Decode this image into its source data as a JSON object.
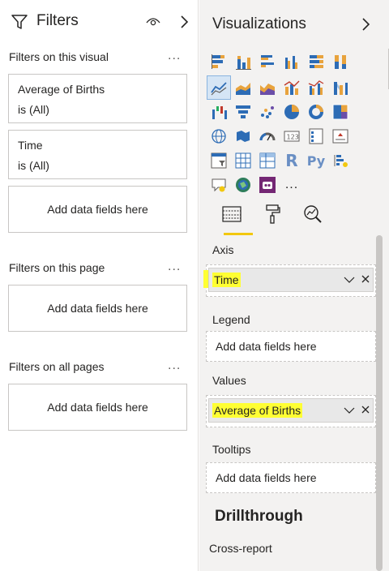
{
  "filters": {
    "title": "Filters",
    "icons": {
      "funnel": "filter-funnel-icon",
      "eye": "eye-icon",
      "collapse": "chevron-right-icon"
    },
    "on_visual": {
      "label": "Filters on this visual",
      "more": "...",
      "cards": [
        {
          "name": "Average of Births",
          "state": "is (All)"
        },
        {
          "name": "Time",
          "state": "is (All)"
        }
      ],
      "add": "Add data fields here"
    },
    "on_page": {
      "label": "Filters on this page",
      "more": "...",
      "add": "Add data fields here"
    },
    "all_pages": {
      "label": "Filters on all pages",
      "more": "...",
      "add": "Add data fields here"
    }
  },
  "viz": {
    "title": "Visualizations",
    "collapse_icon": "chevron-right-icon",
    "more_visuals": "...",
    "r_label": "R",
    "py_label": "Py",
    "selected_visual": "line-chart-icon",
    "tabs": [
      "fields-tab-icon",
      "format-paint-roller-icon",
      "analytics-magnifier-icon"
    ],
    "wells": {
      "axis": {
        "label": "Axis",
        "field": "Time"
      },
      "legend": {
        "label": "Legend",
        "placeholder": "Add data fields here"
      },
      "values": {
        "label": "Values",
        "field": "Average of Births"
      },
      "tooltips": {
        "label": "Tooltips",
        "placeholder": "Add data fields here"
      }
    },
    "drillthrough": {
      "title": "Drillthrough",
      "cross_report": "Cross-report"
    }
  }
}
